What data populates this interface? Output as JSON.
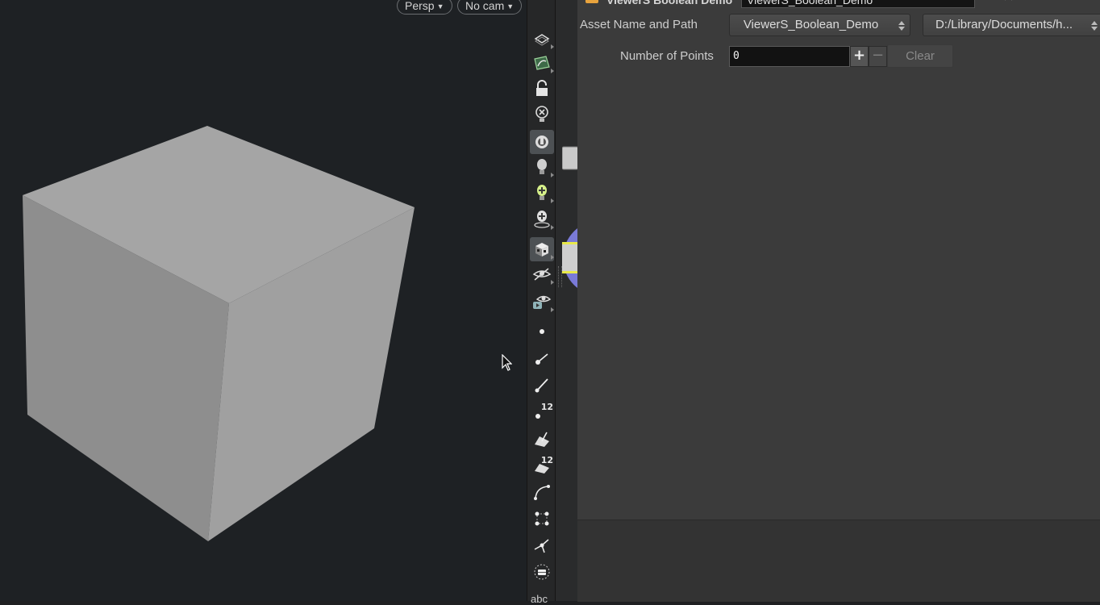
{
  "viewport": {
    "view_menu": "Persp",
    "camera_menu": "No cam",
    "background_color": "#1e2124",
    "object": "cube",
    "cube_colors": {
      "top": "#a5a5a5",
      "left": "#8e8e8e",
      "right": "#a0a0a0"
    }
  },
  "toolbar": {
    "tools": [
      {
        "icon": "display-options-icon",
        "has_menu": true
      },
      {
        "icon": "snapping-icon",
        "has_menu": true
      },
      {
        "icon": "lock-icon",
        "has_menu": false
      },
      {
        "icon": "light-off-icon",
        "has_menu": false
      },
      {
        "icon": "headlight-icon",
        "has_menu": false,
        "active": true
      },
      {
        "icon": "normal-light-icon",
        "has_menu": true
      },
      {
        "icon": "high-quality-light-icon",
        "has_menu": true
      },
      {
        "icon": "high-quality-shadow-icon",
        "has_menu": true
      },
      {
        "icon": "shaded-checker-icon",
        "has_menu": true,
        "active": true
      },
      {
        "icon": "visibility-eye-icon",
        "has_menu": true
      },
      {
        "icon": "visibility-eye-render-icon",
        "has_menu": true
      },
      {
        "icon": "point-icon",
        "has_menu": false
      },
      {
        "icon": "point-normal-icon",
        "has_menu": false
      },
      {
        "icon": "point-normal-line-icon",
        "has_menu": false
      },
      {
        "icon": "point-numbers-icon",
        "has_menu": false,
        "number": "12"
      },
      {
        "icon": "primitive-normal-icon",
        "has_menu": false
      },
      {
        "icon": "primitive-numbers-icon",
        "has_menu": false,
        "number": "12"
      },
      {
        "icon": "curve-handle-icon",
        "has_menu": false
      },
      {
        "icon": "uv-points-icon",
        "has_menu": false
      },
      {
        "icon": "vertex-icon",
        "has_menu": false
      },
      {
        "icon": "frame-icon",
        "has_menu": false
      }
    ],
    "footer_label": "abc"
  },
  "params": {
    "node_type": "ViewerS Boolean Demo",
    "node_name": "ViewerS_Boolean_Demo",
    "asset": {
      "label": "Asset Name and Path",
      "name_value": "ViewerS_Boolean_Demo",
      "path_value": "D:/Library/Documents/h..."
    },
    "points": {
      "label": "Number of Points",
      "value": "0",
      "plus": "+",
      "minus": "−",
      "clear": "Clear"
    },
    "background_color": "#3b3b3b"
  }
}
